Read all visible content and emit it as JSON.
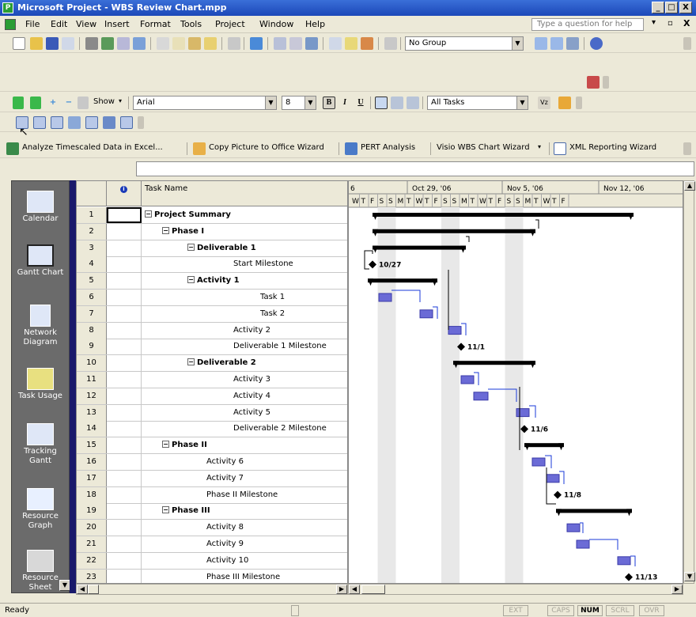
{
  "window": {
    "title": "Microsoft Project - WBS Review Chart.mpp",
    "minimize": "_",
    "maximize": "□",
    "close": "X"
  },
  "menu": {
    "items": [
      "File",
      "Edit",
      "View",
      "Insert",
      "Format",
      "Tools",
      "Project",
      "Window",
      "Help"
    ],
    "help_placeholder": "Type a question for help",
    "doc_close": "X"
  },
  "toolbar_standard": {
    "group_combo": "No Group"
  },
  "toolbar_formatting": {
    "show_label": "Show",
    "font": "Arial",
    "size": "8",
    "bold": "B",
    "italic": "I",
    "underline": "U",
    "filter": "All Tasks"
  },
  "toolbar_analysis": {
    "items": [
      "Analyze Timescaled Data in Excel...",
      "Copy Picture to Office Wizard",
      "PERT Analysis",
      "Visio WBS Chart Wizard",
      "XML Reporting Wizard"
    ]
  },
  "view_bar": {
    "items": [
      "Calendar",
      "Gantt Chart",
      "Network Diagram",
      "Task Usage",
      "Tracking Gantt",
      "Resource Graph",
      "Resource Sheet"
    ],
    "active": "Gantt Chart"
  },
  "table": {
    "col_name": "Task Name",
    "indicator_icon": "info-icon",
    "rows": [
      {
        "id": "1",
        "name": "Project Summary",
        "level": 0,
        "summary": true
      },
      {
        "id": "2",
        "name": "Phase I",
        "level": 1,
        "summary": true
      },
      {
        "id": "3",
        "name": "Deliverable 1",
        "level": 2,
        "summary": true
      },
      {
        "id": "4",
        "name": "Start Milestone",
        "level": 3,
        "summary": false
      },
      {
        "id": "5",
        "name": "Activity 1",
        "level": 3,
        "summary": true
      },
      {
        "id": "6",
        "name": "Task 1",
        "level": 4,
        "summary": false
      },
      {
        "id": "7",
        "name": "Task 2",
        "level": 4,
        "summary": false
      },
      {
        "id": "8",
        "name": "Activity 2",
        "level": 3,
        "summary": false
      },
      {
        "id": "9",
        "name": "Deliverable 1 Milestone",
        "level": 3,
        "summary": false
      },
      {
        "id": "10",
        "name": "Deliverable 2",
        "level": 2,
        "summary": true
      },
      {
        "id": "11",
        "name": "Activity 3",
        "level": 3,
        "summary": false
      },
      {
        "id": "12",
        "name": "Activity 4",
        "level": 3,
        "summary": false
      },
      {
        "id": "13",
        "name": "Activity 5",
        "level": 3,
        "summary": false
      },
      {
        "id": "14",
        "name": "Deliverable 2 Milestone",
        "level": 3,
        "summary": false
      },
      {
        "id": "15",
        "name": "Phase II",
        "level": 1,
        "summary": true
      },
      {
        "id": "16",
        "name": "Activity 6",
        "level": 2,
        "summary": false
      },
      {
        "id": "17",
        "name": "Activity 7",
        "level": 2,
        "summary": false
      },
      {
        "id": "18",
        "name": "Phase II Milestone",
        "level": 2,
        "summary": false
      },
      {
        "id": "19",
        "name": "Phase III",
        "level": 1,
        "summary": true
      },
      {
        "id": "20",
        "name": "Activity 8",
        "level": 2,
        "summary": false
      },
      {
        "id": "21",
        "name": "Activity 9",
        "level": 2,
        "summary": false
      },
      {
        "id": "22",
        "name": "Activity 10",
        "level": 2,
        "summary": false
      },
      {
        "id": "23",
        "name": "Phase III Milestone",
        "level": 2,
        "summary": false
      }
    ]
  },
  "gantt": {
    "weeks": [
      "6",
      "Oct 29, '06",
      "Nov 5, '06",
      "Nov 12, '06"
    ],
    "day_letters": [
      "W",
      "T",
      "F",
      "S",
      "S",
      "M",
      "T",
      "W",
      "T",
      "F",
      "S",
      "S",
      "M",
      "T",
      "W",
      "T",
      "F",
      "S",
      "S",
      "M",
      "T",
      "W",
      "T",
      "F"
    ],
    "milestone_labels": [
      "10/27",
      "11/1",
      "11/6",
      "11/8",
      "11/13"
    ],
    "bar_color": "#6b6bd6",
    "summary_color": "#000000"
  },
  "statusbar": {
    "status": "Ready",
    "indicators": [
      "EXT",
      "CAPS",
      "NUM",
      "SCRL",
      "OVR"
    ],
    "active_indicator": "NUM"
  }
}
